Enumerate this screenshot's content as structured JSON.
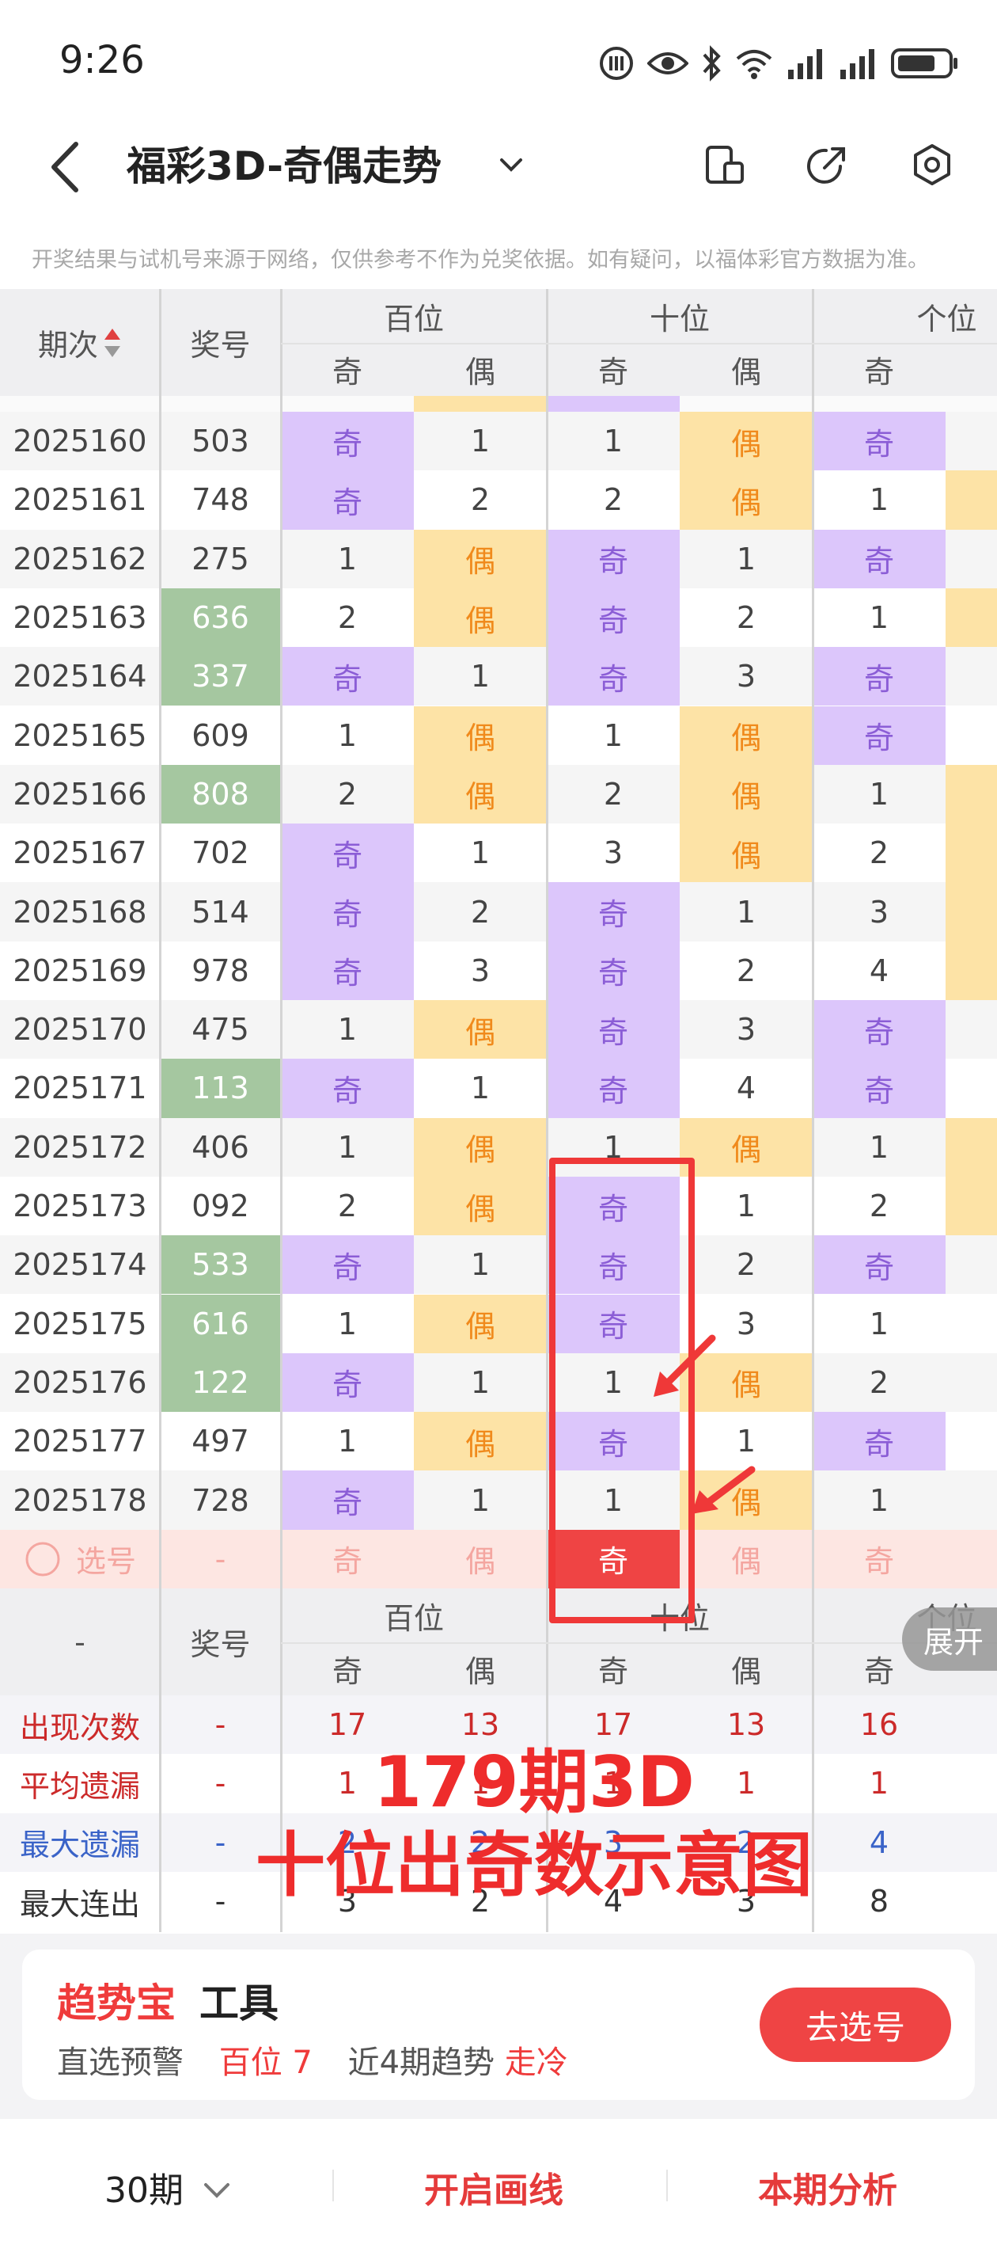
{
  "status_bar": {
    "time": "9:26"
  },
  "header": {
    "title": "福彩3D-奇偶走势"
  },
  "notice": "开奖结果与试机号来源于网络，仅供参考不作为兑奖依据。如有疑问，以福体彩官方数据为准。",
  "table": {
    "col_period": "期次",
    "col_number": "奖号",
    "groups": [
      "百位",
      "十位",
      "个位"
    ],
    "odd": "奇",
    "even": "偶",
    "rows": [
      {
        "period": "2025160",
        "number": "503",
        "hi": false,
        "c": [
          "奇",
          "1",
          "1",
          "偶",
          "奇"
        ]
      },
      {
        "period": "2025161",
        "number": "748",
        "hi": false,
        "c": [
          "奇",
          "2",
          "2",
          "偶",
          "1"
        ]
      },
      {
        "period": "2025162",
        "number": "275",
        "hi": false,
        "c": [
          "1",
          "偶",
          "奇",
          "1",
          "奇"
        ]
      },
      {
        "period": "2025163",
        "number": "636",
        "hi": true,
        "c": [
          "2",
          "偶",
          "奇",
          "2",
          "1"
        ]
      },
      {
        "period": "2025164",
        "number": "337",
        "hi": true,
        "c": [
          "奇",
          "1",
          "奇",
          "3",
          "奇"
        ]
      },
      {
        "period": "2025165",
        "number": "609",
        "hi": false,
        "c": [
          "1",
          "偶",
          "1",
          "偶",
          "奇"
        ]
      },
      {
        "period": "2025166",
        "number": "808",
        "hi": true,
        "c": [
          "2",
          "偶",
          "2",
          "偶",
          "1"
        ]
      },
      {
        "period": "2025167",
        "number": "702",
        "hi": false,
        "c": [
          "奇",
          "1",
          "3",
          "偶",
          "2"
        ]
      },
      {
        "period": "2025168",
        "number": "514",
        "hi": false,
        "c": [
          "奇",
          "2",
          "奇",
          "1",
          "3"
        ]
      },
      {
        "period": "2025169",
        "number": "978",
        "hi": false,
        "c": [
          "奇",
          "3",
          "奇",
          "2",
          "4"
        ]
      },
      {
        "period": "2025170",
        "number": "475",
        "hi": false,
        "c": [
          "1",
          "偶",
          "奇",
          "3",
          "奇"
        ]
      },
      {
        "period": "2025171",
        "number": "113",
        "hi": true,
        "c": [
          "奇",
          "1",
          "奇",
          "4",
          "奇"
        ]
      },
      {
        "period": "2025172",
        "number": "406",
        "hi": false,
        "c": [
          "1",
          "偶",
          "1",
          "偶",
          "1"
        ]
      },
      {
        "period": "2025173",
        "number": "092",
        "hi": false,
        "c": [
          "2",
          "偶",
          "奇",
          "1",
          "2"
        ]
      },
      {
        "period": "2025174",
        "number": "533",
        "hi": true,
        "c": [
          "奇",
          "1",
          "奇",
          "2",
          "奇"
        ]
      },
      {
        "period": "2025175",
        "number": "616",
        "hi": true,
        "c": [
          "1",
          "偶",
          "奇",
          "3",
          "1"
        ]
      },
      {
        "period": "2025176",
        "number": "122",
        "hi": true,
        "c": [
          "奇",
          "1",
          "1",
          "偶",
          "2"
        ]
      },
      {
        "period": "2025177",
        "number": "497",
        "hi": false,
        "c": [
          "1",
          "偶",
          "奇",
          "1",
          "奇"
        ]
      },
      {
        "period": "2025178",
        "number": "728",
        "hi": false,
        "c": [
          "奇",
          "1",
          "1",
          "偶",
          "1"
        ]
      }
    ],
    "select_row": {
      "label": "选号",
      "dash": "-",
      "c": [
        "奇",
        "偶",
        "奇",
        "偶",
        "奇"
      ]
    },
    "stats_header": {
      "dash": "-",
      "number": "奖号"
    },
    "stats": [
      {
        "label": "出现次数",
        "dash": "-",
        "color": "red",
        "v": [
          "17",
          "13",
          "17",
          "13",
          "16"
        ]
      },
      {
        "label": "平均遗漏",
        "dash": "-",
        "color": "red",
        "v": [
          "1",
          "1",
          "1",
          "1",
          "1"
        ]
      },
      {
        "label": "最大遗漏",
        "dash": "-",
        "color": "blue",
        "v": [
          "2",
          "2",
          "3",
          "2",
          "4"
        ]
      },
      {
        "label": "最大连出",
        "dash": "-",
        "color": "dark",
        "v": [
          "3",
          "2",
          "4",
          "3",
          "8"
        ]
      }
    ]
  },
  "overlay": {
    "line1": "179期3D",
    "line2": "十位出奇数示意图"
  },
  "expand_label": "展开",
  "tool_card": {
    "title_red": "趋势宝",
    "title_dark": "工具",
    "label1": "直选预警",
    "value1": "百位 7",
    "label2": "近4期趋势",
    "value2": "走冷",
    "button": "去选号"
  },
  "bottom_bar": {
    "periods": "30期",
    "draw_lines": "开启画线",
    "analysis": "本期分析"
  },
  "colors": {
    "odd_bg": "#dcc6fb",
    "even_bg": "#fde3a6",
    "odd_text": "#8b5dd6",
    "even_text": "#f08a1c",
    "number_hi": "#a5c7a0",
    "accent": "#ef3b3b"
  }
}
